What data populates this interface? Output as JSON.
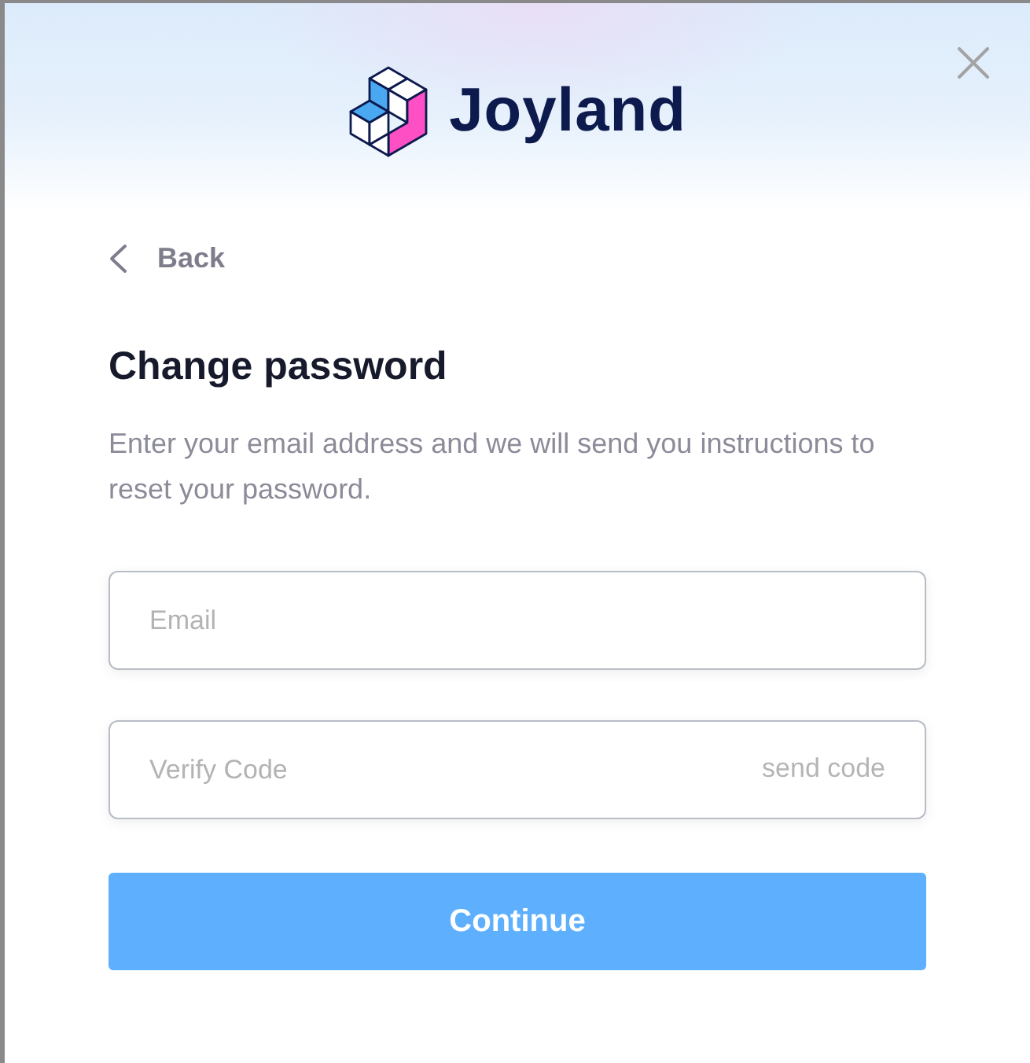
{
  "header": {
    "logo_text": "Joyland"
  },
  "back": {
    "label": "Back"
  },
  "title": "Change password",
  "description": "Enter your email address and we will send you instructions to reset your password.",
  "fields": [
    {
      "kind": "text",
      "placeholder": "Email"
    },
    {
      "kind": "code",
      "placeholder": "Verify Code",
      "action": "send code"
    }
  ],
  "buttons": [
    {
      "label": "Continue"
    }
  ]
}
